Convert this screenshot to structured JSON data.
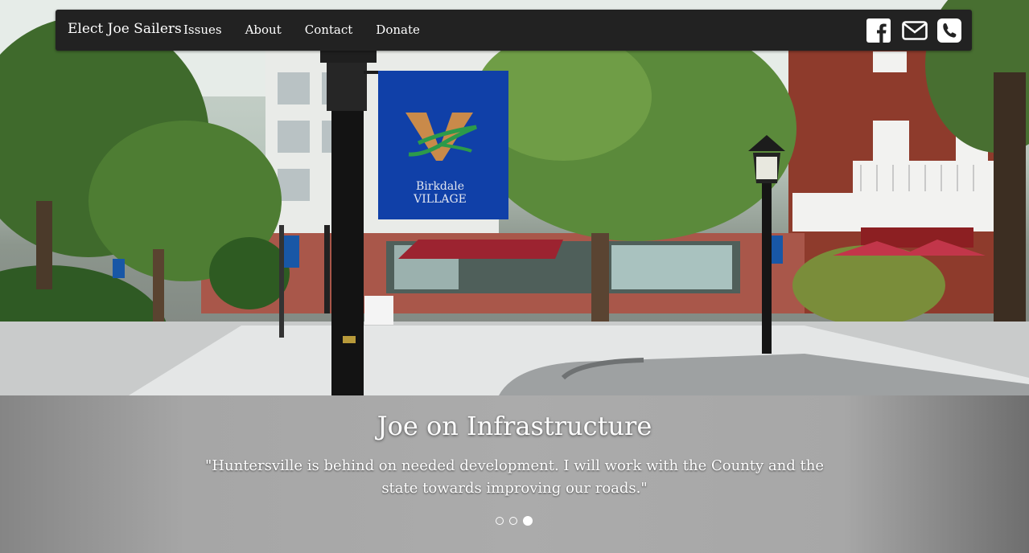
{
  "navbar": {
    "brand": "Elect Joe Sailers",
    "links": [
      "Issues",
      "About",
      "Contact",
      "Donate"
    ],
    "icons": [
      "facebook-icon",
      "envelope-icon",
      "phone-icon"
    ]
  },
  "hero": {
    "banner_line1": "Birkdale",
    "banner_line2": "VILLAGE"
  },
  "carousel": {
    "title": "Joe on Infrastructure",
    "quote": "\"Huntersville is behind on needed development. I will work with the County and the state towards improving our roads.\"",
    "slide_count": 3,
    "active_slide": 3
  },
  "colors": {
    "navbar_bg": "#222222",
    "banner_blue": "#1040a8",
    "caption_bg": "#a8a8a8"
  }
}
